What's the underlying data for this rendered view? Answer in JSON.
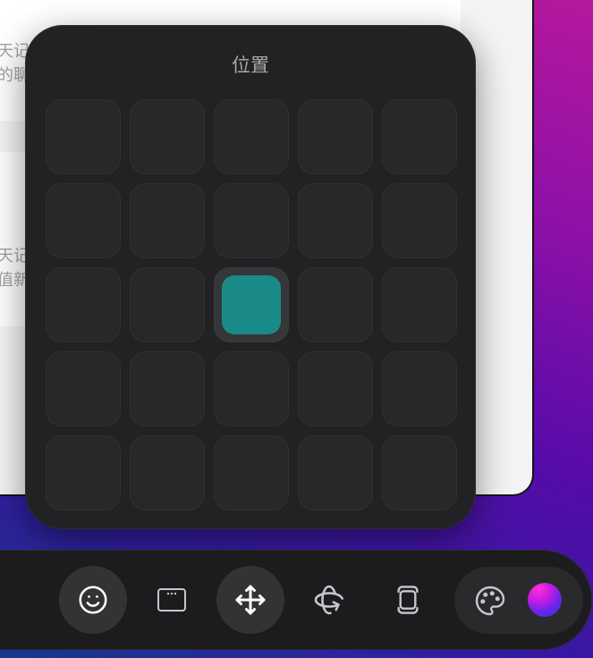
{
  "colors": {
    "accent": "#1a8a89",
    "panel_background": "#222224",
    "toolbar_background": "#1c1c1e",
    "active_button": "#333336"
  },
  "background_window": {
    "snippets": [
      "天记",
      "的聊",
      "天记",
      "值新"
    ]
  },
  "position_panel": {
    "title": "位置",
    "grid": [
      [
        false,
        false,
        false,
        false,
        false
      ],
      [
        false,
        false,
        false,
        false,
        false
      ],
      [
        false,
        false,
        true,
        false,
        false
      ],
      [
        false,
        false,
        false,
        false,
        false
      ],
      [
        false,
        false,
        false,
        false,
        false
      ]
    ]
  },
  "toolbar": {
    "buttons": [
      {
        "icon": "smiley-icon",
        "active": true
      },
      {
        "icon": "window-icon",
        "active": false
      },
      {
        "icon": "move-icon",
        "active": true
      },
      {
        "icon": "orbit-icon",
        "active": false
      },
      {
        "icon": "layers-icon",
        "active": false
      }
    ],
    "palette": {
      "icon": "palette-icon"
    },
    "color_swatch": {
      "colors": [
        "#ff30d8",
        "#cc1ce2",
        "#6a24ea",
        "#2440de"
      ]
    }
  }
}
